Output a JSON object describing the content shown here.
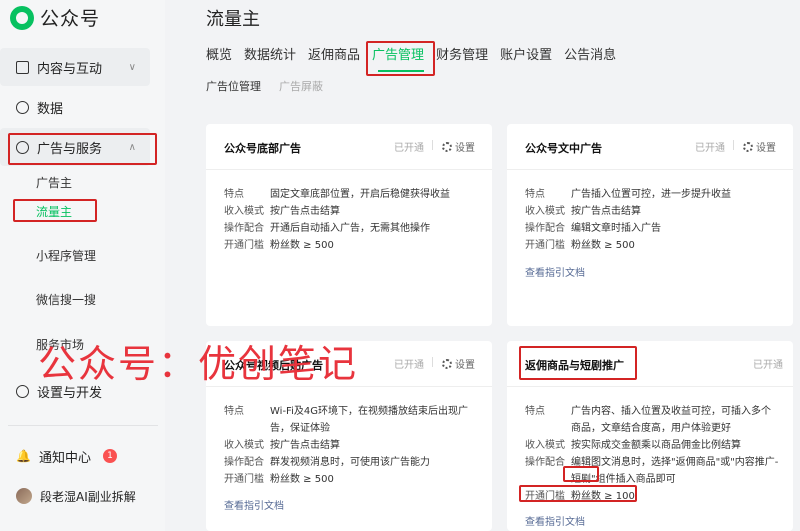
{
  "app": {
    "logo_text": "公众号"
  },
  "sidebar": {
    "groups": [
      {
        "label": "内容与互动",
        "icon": "document-icon"
      },
      {
        "label": "数据",
        "icon": "pie-chart-icon"
      },
      {
        "label": "广告与服务",
        "icon": "compass-icon"
      }
    ],
    "ad_sub": [
      "广告主",
      "流量主"
    ],
    "items": [
      "小程序管理",
      "微信搜一搜",
      "服务市场"
    ],
    "dev": "设置与开发",
    "notifications": {
      "label": "通知中心",
      "count": "1"
    },
    "user": "段老湿AI副业拆解"
  },
  "main": {
    "title": "流量主",
    "tabs": [
      "概览",
      "数据统计",
      "返佣商品",
      "广告管理",
      "财务管理",
      "账户设置",
      "公告消息"
    ],
    "active_tab": "广告管理",
    "subtabs": [
      "广告位管理",
      "广告屏蔽"
    ]
  },
  "cards": [
    {
      "title": "公众号底部广告",
      "status": "已开通",
      "settings": "设置",
      "rows": [
        {
          "k": "特点",
          "v": "固定文章底部位置，开启后稳健获得收益"
        },
        {
          "k": "收入模式",
          "v": "按广告点击结算"
        },
        {
          "k": "操作配合",
          "v": "开通后自动插入广告，无需其他操作"
        },
        {
          "k": "开通门槛",
          "v": "粉丝数 ≥ 500"
        }
      ]
    },
    {
      "title": "公众号文中广告",
      "status": "已开通",
      "settings": "设置",
      "rows": [
        {
          "k": "特点",
          "v": "广告插入位置可控，进一步提升收益"
        },
        {
          "k": "收入模式",
          "v": "按广告点击结算"
        },
        {
          "k": "操作配合",
          "v": "编辑文章时插入广告"
        },
        {
          "k": "开通门槛",
          "v": "粉丝数 ≥ 500"
        }
      ],
      "link": "查看指引文档"
    },
    {
      "title": "公众号视频后贴广告",
      "status": "已开通",
      "settings": "设置",
      "rows": [
        {
          "k": "特点",
          "v": "Wi-Fi及4G环境下，在视频播放结束后出现广告，保证体验"
        },
        {
          "k": "收入模式",
          "v": "按广告点击结算"
        },
        {
          "k": "操作配合",
          "v": "群发视频消息时，可使用该广告能力"
        },
        {
          "k": "开通门槛",
          "v": "粉丝数 ≥ 500"
        }
      ],
      "link": "查看指引文档"
    },
    {
      "title": "返佣商品与短剧推广",
      "status": "已开通",
      "rows": [
        {
          "k": "特点",
          "v": "广告内容、插入位置及收益可控，可插入多个商品，文章结合度高，用户体验更好"
        },
        {
          "k": "收入模式",
          "v": "按实际成交金额乘以商品佣金比例结算"
        },
        {
          "k": "操作配合",
          "v": "编辑图文消息时，选择\"返佣商品\"或\"内容推广-短剧\"组件插入商品即可"
        },
        {
          "k": "开通门槛",
          "v": "粉丝数 ≥ 100"
        }
      ],
      "link": "查看指引文档"
    }
  ],
  "watermark": "公众号：优创笔记"
}
